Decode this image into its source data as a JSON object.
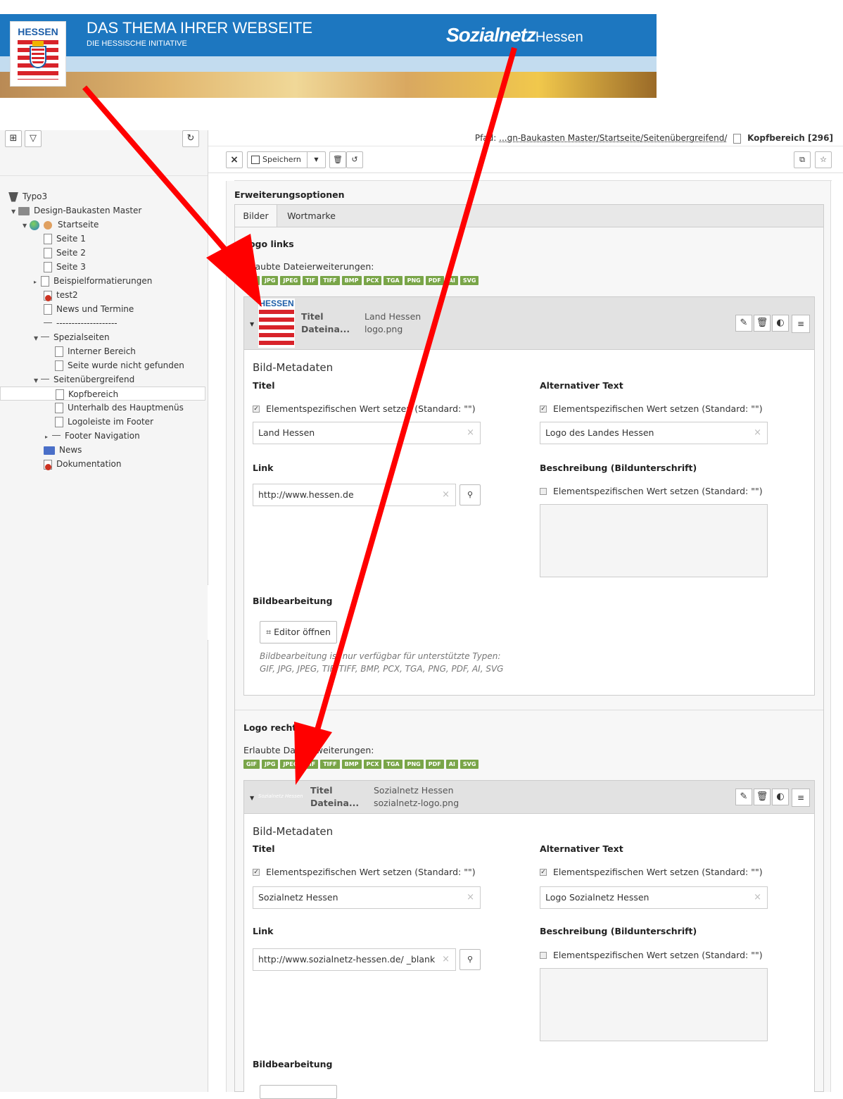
{
  "banner": {
    "logo_text": "HESSEN",
    "title": "DAS THEMA IHRER WEBSEITE",
    "subtitle": "DIE HESSISCHE INITIATIVE",
    "brand_main": "Sozialnetz",
    "brand_suffix": "Hessen",
    "colors": {
      "blue": "#1d77c0",
      "light_blue": "#c3dcef",
      "red": "#d8232a"
    }
  },
  "tree": {
    "items": [
      {
        "label": "Typo3"
      },
      {
        "label": "Design-Baukasten Master"
      },
      {
        "label": "Startseite"
      },
      {
        "label": "Seite 1"
      },
      {
        "label": "Seite 2"
      },
      {
        "label": "Seite 3"
      },
      {
        "label": "Beispielformatierungen"
      },
      {
        "label": "test2"
      },
      {
        "label": "News und Termine"
      },
      {
        "label": "--------------------"
      },
      {
        "label": "Spezialseiten"
      },
      {
        "label": "Interner Bereich"
      },
      {
        "label": "Seite wurde nicht gefunden"
      },
      {
        "label": "Seitenübergreifend"
      },
      {
        "label": "Kopfbereich"
      },
      {
        "label": "Unterhalb des Hauptmenüs"
      },
      {
        "label": "Logoleiste im Footer"
      },
      {
        "label": "Footer Navigation"
      },
      {
        "label": "News"
      },
      {
        "label": "Dokumentation"
      }
    ]
  },
  "header": {
    "path_label": "Pfad:",
    "path_value": "...gn-Baukasten Master/Startseite/Seitenübergreifend/",
    "page_name": "Kopfbereich [296]",
    "save_label": "Speichern",
    "close_symbol": "×"
  },
  "form": {
    "section_title": "Erweiterungsoptionen",
    "tabs": [
      {
        "label": "Bilder"
      },
      {
        "label": "Wortmarke"
      }
    ],
    "allowed_label": "Erlaubte Dateierweiterungen:",
    "extensions": [
      "GIF",
      "JPG",
      "JPEG",
      "TIF",
      "TIFF",
      "BMP",
      "PCX",
      "TGA",
      "PNG",
      "PDF",
      "AI",
      "SVG"
    ],
    "logo_left": {
      "heading": "Logo links",
      "thumb_text": "HESSEN",
      "meta_title_label": "Titel",
      "meta_file_label": "Dateina...",
      "meta_title_value": "Land Hessen",
      "meta_file_value": "logo.png",
      "metadata_heading": "Bild-Metadaten",
      "titel_label": "Titel",
      "alt_label": "Alternativer Text",
      "checkbox_text": "Elementspezifischen Wert setzen (Standard: \"\")",
      "titel_value": "Land Hessen",
      "alt_value": "Logo des Landes Hessen",
      "link_label": "Link",
      "link_value": "http://www.hessen.de",
      "desc_label": "Beschreibung (Bildunterschrift)",
      "edit_heading": "Bildbearbeitung",
      "editor_button": "Editor öffnen",
      "edit_note_1": "Bildbearbeitung ist nur verfügbar für unterstützte Typen:",
      "edit_note_2": "GIF, JPG, JPEG, TIF, TIFF, BMP, PCX, TGA, PNG, PDF, AI, SVG"
    },
    "logo_right": {
      "heading": "Logo rechts",
      "thumb_text": "Sozialnetz Hessen",
      "meta_title_label": "Titel",
      "meta_file_label": "Dateina...",
      "meta_title_value": "Sozialnetz Hessen",
      "meta_file_value": "sozialnetz-logo.png",
      "metadata_heading": "Bild-Metadaten",
      "titel_label": "Titel",
      "alt_label": "Alternativer Text",
      "checkbox_text": "Elementspezifischen Wert setzen (Standard: \"\")",
      "titel_value": "Sozialnetz Hessen",
      "alt_value": "Logo Sozialnetz Hessen",
      "link_label": "Link",
      "link_value": "http://www.sozialnetz-hessen.de/ _blank",
      "desc_label": "Beschreibung (Bildunterschrift)",
      "edit_heading": "Bildbearbeitung"
    }
  },
  "annotation": {
    "arrow_color": "#ff0000"
  }
}
